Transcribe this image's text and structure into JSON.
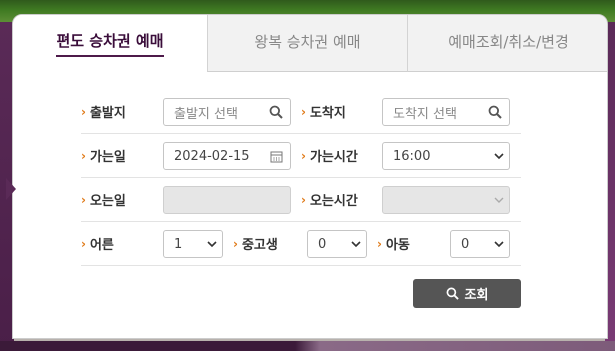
{
  "tabs": [
    {
      "label": "편도 승차권 예매",
      "active": true
    },
    {
      "label": "왕복 승차권 예매",
      "active": false
    },
    {
      "label": "예매조회/취소/변경",
      "active": false
    }
  ],
  "form": {
    "departure": {
      "label": "출발지",
      "placeholder": "출발지 선택"
    },
    "arrival": {
      "label": "도착지",
      "placeholder": "도착지 선택"
    },
    "go_date": {
      "label": "가는일",
      "value": "2024-02-15"
    },
    "go_time": {
      "label": "가는시간",
      "value": "16:00"
    },
    "return_date": {
      "label": "오는일",
      "value": ""
    },
    "return_time": {
      "label": "오는시간",
      "value": ""
    },
    "adult": {
      "label": "어른",
      "value": "1"
    },
    "youth": {
      "label": "중고생",
      "value": "0"
    },
    "child": {
      "label": "아동",
      "value": "0"
    }
  },
  "search_button": {
    "label": "조회"
  },
  "colors": {
    "accent": "#4d1a4a",
    "arrow": "#e07b1a",
    "button": "#555555"
  }
}
